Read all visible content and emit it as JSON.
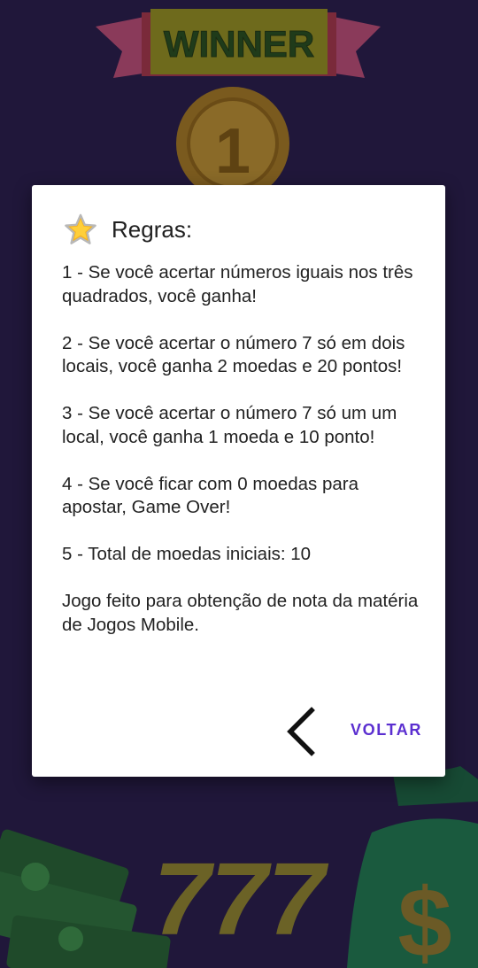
{
  "background": {
    "banner_text": "WINNER",
    "medal_number": "1",
    "slot_text": "777",
    "bag_symbol": "$"
  },
  "dialog": {
    "title": "Regras:",
    "icon": "star-icon",
    "rules": [
      "1 - Se você acertar números iguais nos três quadrados, você ganha!",
      "2 - Se você acertar o número 7 só em dois locais, você ganha 2 moedas e 20 pontos!",
      "3 - Se você acertar o número 7 só um um local, você ganha 1 moeda e 10 ponto!",
      "4 - Se você ficar com 0 moedas para apostar, Game Over!",
      "5 - Total de moedas iniciais: 10",
      "Jogo feito para obtenção de nota da matéria de Jogos Mobile."
    ],
    "back_icon": "chevron-left-icon",
    "button_label": "VOLTAR"
  },
  "colors": {
    "background": "#20173a",
    "accent": "#5b2fd0",
    "dialog": "#ffffff"
  }
}
